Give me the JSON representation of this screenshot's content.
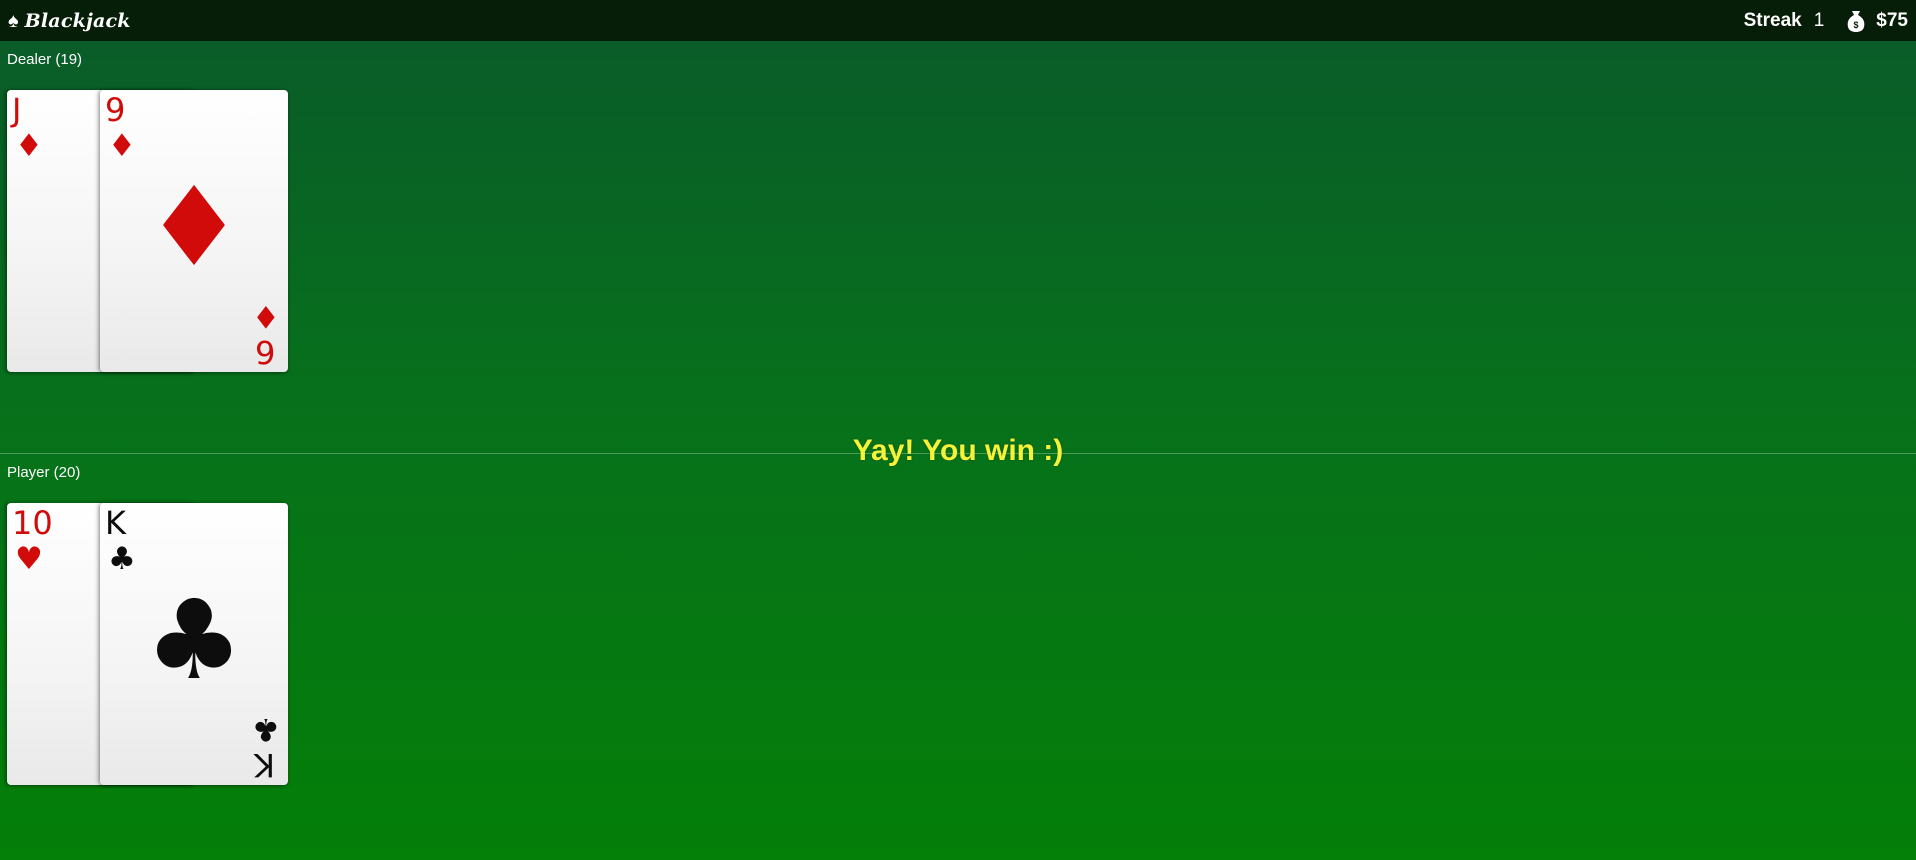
{
  "app": {
    "title": "Blackjack",
    "icon": "spade-icon"
  },
  "stats": {
    "streak_label": "Streak",
    "streak_value": "1",
    "money": "$75",
    "money_icon": "money-bag-icon"
  },
  "dealer": {
    "label": "Dealer (19)",
    "cards": [
      {
        "rank": "J",
        "rank_bottom": "",
        "suit": "♦",
        "suit_name": "diamonds",
        "color": "#d10a0a"
      },
      {
        "rank": "9",
        "rank_bottom": "6",
        "suit": "♦",
        "suit_name": "diamonds",
        "color": "#d10a0a"
      }
    ]
  },
  "player": {
    "label": "Player (20)",
    "cards": [
      {
        "rank": "10",
        "rank_bottom": "",
        "suit": "♥",
        "suit_name": "hearts",
        "color": "#d10a0a"
      },
      {
        "rank": "K",
        "rank_bottom": "K",
        "suit": "♣",
        "suit_name": "clubs",
        "color": "#0d0d0d"
      }
    ]
  },
  "message": "Yay! You win :)",
  "colors": {
    "topbar": "#061d07",
    "table_top": "#0a5a2a",
    "table_bottom": "#047f08",
    "message": "#f6f238"
  }
}
